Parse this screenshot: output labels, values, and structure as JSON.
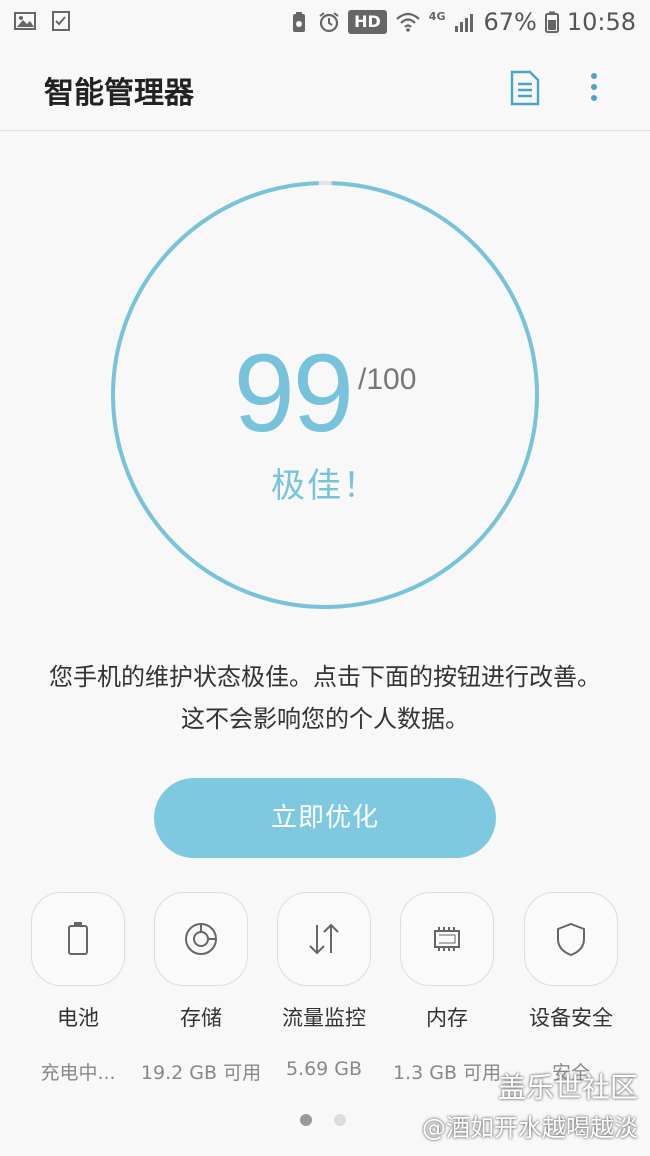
{
  "status_bar": {
    "hd_label": "HD",
    "network_label": "4G",
    "battery": "67%",
    "time": "10:58",
    "icons": [
      "image-icon",
      "task-icon",
      "recycle-battery-icon",
      "alarm-icon",
      "wifi-icon",
      "signal-icon",
      "battery-icon"
    ]
  },
  "app_bar": {
    "title": "智能管理器",
    "icons": [
      "report-icon",
      "more-options-icon"
    ]
  },
  "score": {
    "value": "99",
    "max": "/100",
    "rating": "极佳！",
    "ring_fraction": 0.99,
    "color": "#78c3dc"
  },
  "description": "您手机的维护状态极佳。点击下面的按钮进行改善。这不会影响您的个人数据。",
  "optimize_button": {
    "label": "立即优化",
    "color": "#7fc9e0"
  },
  "categories": [
    {
      "label": "电池",
      "value": "充电中...",
      "icon": "battery-icon"
    },
    {
      "label": "存储",
      "value": "19.2 GB 可用",
      "icon": "storage-icon"
    },
    {
      "label": "流量监控",
      "value": "5.69 GB",
      "icon": "data-transfer-icon"
    },
    {
      "label": "内存",
      "value": "1.3 GB 可用",
      "icon": "memory-chip-icon"
    },
    {
      "label": "设备安全",
      "value": "安全",
      "icon": "shield-icon"
    }
  ],
  "pager": {
    "pages": 2,
    "current": 1
  },
  "watermark": {
    "line1": "盖乐世社区",
    "line2": "@酒如开水越喝越淡"
  }
}
